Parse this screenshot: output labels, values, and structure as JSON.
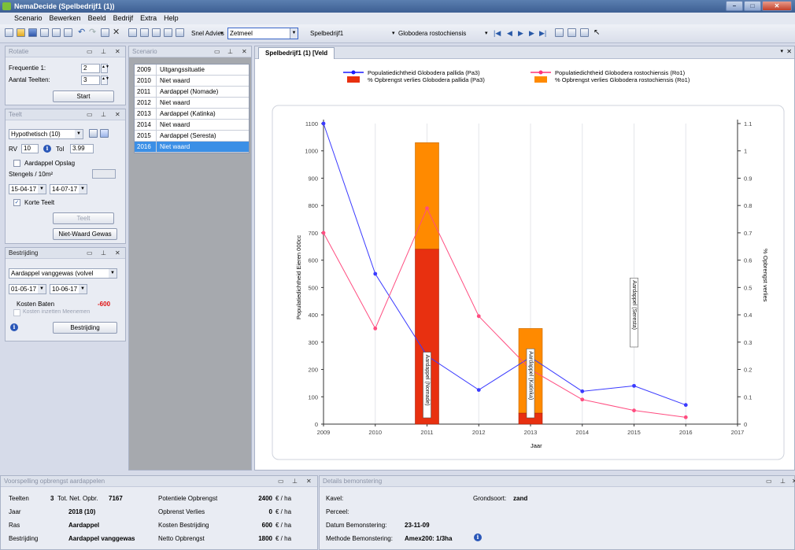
{
  "window": {
    "title": "NemaDecide (Spelbedrijf1 (1))"
  },
  "menu": [
    "Scenario",
    "Bewerken",
    "Beeld",
    "Bedrijf",
    "Extra",
    "Help"
  ],
  "toolbar": {
    "snel_advies_label": "Snel Advies",
    "snel_advies_value": "Zetmeel",
    "bedrijf_value": "Spelbedrijf1",
    "species_value": "Globodera rostochiensis"
  },
  "rotatie": {
    "title": "Rotatie",
    "freq_label": "Frequentie 1:",
    "freq_value": "2",
    "teelten_label": "Aantal Teelten:",
    "teelten_value": "3",
    "start_label": "Start"
  },
  "teelt": {
    "title": "Teelt",
    "ras": "Hypothetisch (10)",
    "rv_label": "RV",
    "rv_value": "10",
    "tol_label": "Tol",
    "tol_value": "3.99",
    "opslag_label": "Aardappel Opslag",
    "stengels_label": "Stengels / 10m²",
    "date1": "15-04-17",
    "date2": "14-07-17",
    "korte_label": "Korte Teelt",
    "teelt_btn": "Teelt",
    "nietwaard_btn": "Niet-Waard Gewas"
  },
  "bestrijding": {
    "title": "Bestrijding",
    "method": "Aardappel vanggewas (volvel",
    "date1": "01-05-17",
    "date2": "10-06-17",
    "kosten_label": "Kosten Baten",
    "kosten_value": "-600",
    "meenemen_label": "Kosten inzetten Meenemen",
    "btn": "Bestrijding"
  },
  "scenario": {
    "title": "Scenario",
    "rows": [
      {
        "year": "2009",
        "name": "Uitgangssituatie"
      },
      {
        "year": "2010",
        "name": "Niet waard"
      },
      {
        "year": "2011",
        "name": "Aardappel (Nomade)"
      },
      {
        "year": "2012",
        "name": "Niet waard"
      },
      {
        "year": "2013",
        "name": "Aardappel (Katinka)"
      },
      {
        "year": "2014",
        "name": "Niet waard"
      },
      {
        "year": "2015",
        "name": "Aardappel (Seresta)"
      },
      {
        "year": "2016",
        "name": "Niet waard"
      }
    ]
  },
  "chart_tab": "Spelbedrijf1 (1) [Veld",
  "chart_data": {
    "type": "line",
    "title": "",
    "xlabel": "Jaar",
    "ylabel": "Populatiedichtheid Eieren 000cc",
    "y2label": "% Opbrengst verlies",
    "x_ticks": [
      "2009",
      "2010",
      "2011",
      "2012",
      "2013",
      "2014",
      "2015",
      "2016",
      "2017"
    ],
    "ylim": [
      0,
      1100
    ],
    "y_ticks": [
      "0",
      "100",
      "200",
      "300",
      "400",
      "500",
      "600",
      "700",
      "800",
      "900",
      "1000",
      "1100"
    ],
    "y2lim": [
      0,
      1.1
    ],
    "y2_ticks": [
      "0",
      "0.1",
      "0.2",
      "0.3",
      "0.4",
      "0.5",
      "0.6",
      "0.7",
      "0.8",
      "0.9",
      "1",
      "1.1"
    ],
    "legend": [
      {
        "label": "Populatiedichtheid Globodera pallida (Pa3)",
        "color": "#1a1aff",
        "kind": "line"
      },
      {
        "label": "Populatiedichtheid Globodera rostochiensis (Ro1)",
        "color": "#ff3377",
        "kind": "line"
      },
      {
        "label": "% Opbrengst verlies Globodera pallida (Pa3)",
        "color": "#e83010",
        "kind": "bar"
      },
      {
        "label": "% Opbrengst verlies Globodera rostochiensis (Ro1)",
        "color": "#ff8a00",
        "kind": "bar"
      }
    ],
    "series": [
      {
        "name": "Populatiedichtheid Globodera pallida (Pa3)",
        "color": "#3a3aff",
        "x": [
          2009,
          2010,
          2011,
          2012,
          2013,
          2014,
          2015,
          2016
        ],
        "values": [
          1100,
          550,
          250,
          125,
          245,
          120,
          140,
          70
        ]
      },
      {
        "name": "Populatiedichtheid Globodera rostochiensis (Ro1)",
        "color": "#ff4d80",
        "x": [
          2009,
          2010,
          2011,
          2012,
          2013,
          2014,
          2015,
          2016
        ],
        "values": [
          700,
          350,
          790,
          395,
          200,
          90,
          50,
          25
        ]
      }
    ],
    "bars": [
      {
        "x": 2011,
        "pallida": 0.64,
        "rostochiensis": 0.39,
        "label": "Aardappel (Nomade)"
      },
      {
        "x": 2013,
        "pallida": 0.04,
        "rostochiensis": 0.31,
        "label": "Aardappel (Katinka)"
      },
      {
        "x": 2015,
        "pallida": 0,
        "rostochiensis": 0,
        "label": "Aardappel (Seresta)"
      }
    ]
  },
  "voorspelling": {
    "title": "Voorspelling opbrengst aardappelen",
    "teelten_label": "Teelten",
    "teelten_value": "3",
    "totnet_label": "Tot. Net. Opbr.",
    "totnet_value": "7167",
    "jaar_label": "Jaar",
    "jaar_value": "2018 (10)",
    "ras_label": "Ras",
    "ras_value": "Aardappel",
    "bestrijding_label": "Bestrijding",
    "bestrijding_value": "Aardappel vanggewas",
    "pot_label": "Potentiele Opbrengst",
    "pot_value": "2400",
    "verlies_label": "Opbrenst Verlies",
    "verlies_value": "0",
    "kosten_label": "Kosten Bestrijding",
    "kosten_value": "600",
    "netto_label": "Netto Opbrengst",
    "netto_value": "1800",
    "unit": "€ / ha"
  },
  "details": {
    "title": "Details bemonstering",
    "kavel_label": "Kavel:",
    "perceel_label": "Perceel:",
    "datum_label": "Datum Bemonstering:",
    "datum_value": "23-11-09",
    "methode_label": "Methode Bemonstering:",
    "methode_value": "Amex200: 1/3ha",
    "grond_label": "Grondsoort:",
    "grond_value": "zand"
  }
}
